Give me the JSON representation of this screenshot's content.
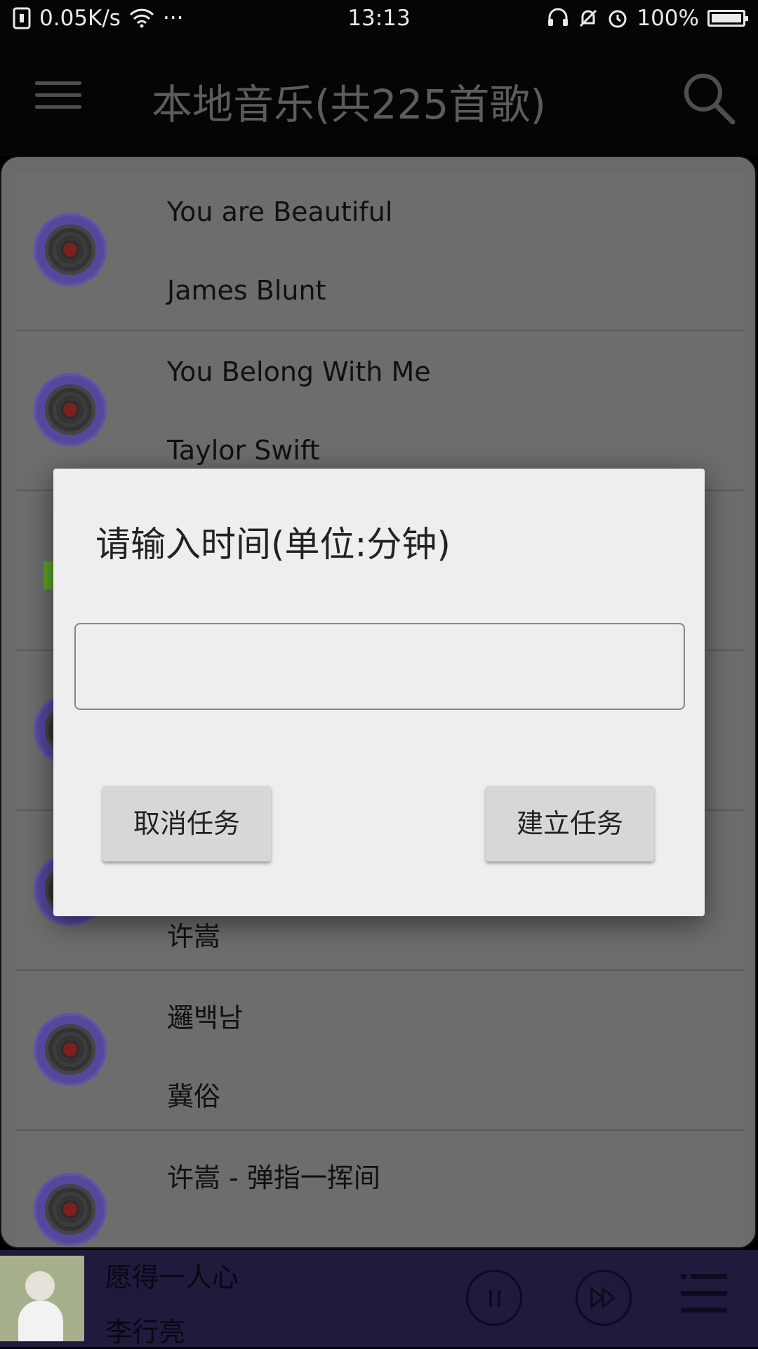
{
  "status_bar": {
    "net_speed": "0.05K/s",
    "dots": "···",
    "time": "13:13",
    "battery": "100%"
  },
  "app_bar": {
    "title": "本地音乐(共225首歌)",
    "menu_icon": "hamburger-menu-icon",
    "search_icon": "search-icon"
  },
  "songs": [
    {
      "title": "You are Beautiful",
      "artist": "James Blunt"
    },
    {
      "title": "You Belong With Me",
      "artist": "Taylor Swift"
    },
    {
      "title": "",
      "artist": ""
    },
    {
      "title": "",
      "artist": ""
    },
    {
      "title": "",
      "artist": "许嵩"
    },
    {
      "title": "邏백남",
      "artist": "冀俗"
    },
    {
      "title": "许嵩 - 弹指一挥间",
      "artist": ""
    }
  ],
  "dialog": {
    "title": "请输入时间(单位:分钟)",
    "input_value": "",
    "cancel_label": "取消任务",
    "create_label": "建立任务"
  },
  "player": {
    "title": "愿得一人心",
    "artist": "李行亮"
  },
  "colors": {
    "player_bg": "#201a3c",
    "disc_accent": "#55479a",
    "dialog_bg": "#eeeeee"
  }
}
